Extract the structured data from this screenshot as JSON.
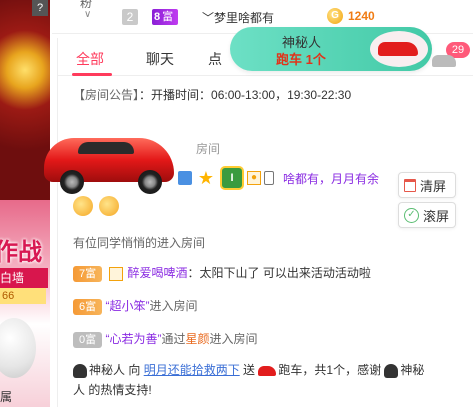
{
  "top": {
    "prev_text": "粉",
    "rank": "2",
    "fu_level": "8",
    "fu_label": "富",
    "username": "﹀梦里啥都有",
    "coin_symbol": "G",
    "coin_amount": "1240"
  },
  "left": {
    "help": "?",
    "zuozhan": "作战",
    "baiqiang": "白墙",
    "num": "66",
    "bottom": "属"
  },
  "tabs": [
    {
      "label": "全部"
    },
    {
      "label": "聊天"
    },
    {
      "label": "点"
    }
  ],
  "gift_banner": {
    "who": "神秘人",
    "what": "跑车 1个"
  },
  "badge_count": "29",
  "announcement": {
    "tag": "【房间公告】",
    "text": "：开播时间：06:00-13:00，19:30-22:30"
  },
  "row2": "房间",
  "row3": {
    "shield": "I",
    "text": "啥都有，月月有余"
  },
  "side_buttons": {
    "clear": "清屏",
    "scroll": "滚屏"
  },
  "row4": "有位同学悄悄的进入房间",
  "row5": {
    "level": "7富",
    "name": "醉爱喝啤酒",
    "text": "：太阳下山了 可以出来活动活动啦"
  },
  "row6": {
    "level": "6富",
    "name": "“超小笨”",
    "text": "进入房间"
  },
  "row7": {
    "level": "0富",
    "name": "“心若为善”",
    "via": "通过",
    "way": "星颜",
    "text": "进入房间"
  },
  "gift_line": {
    "sender": "神秘人",
    "to": " 向 ",
    "receiver": "明月还能拾救两下",
    "send": " 送 ",
    "gift": "跑车",
    "count": "，共1个，感谢 ",
    "sender2": "神秘",
    "tail": "人 的热情支持!"
  },
  "colors": {
    "accent": "#ff3b5c",
    "purple_name": "#8a2be2",
    "coin": "#f07c14"
  }
}
